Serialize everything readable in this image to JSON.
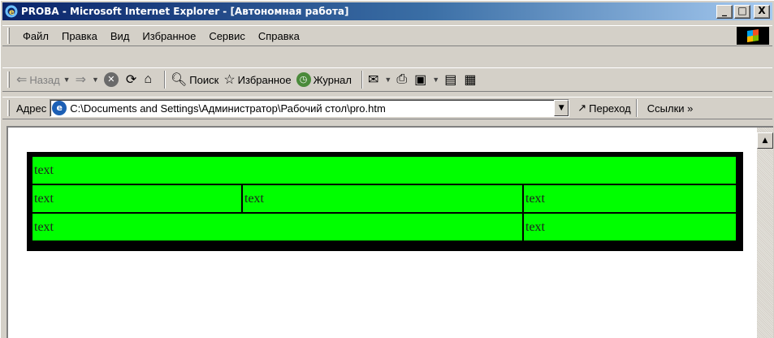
{
  "window": {
    "title": "PROBA - Microsoft Internet Explorer - [Автономная работа]",
    "buttons": {
      "minimize": "_",
      "maximize": "□",
      "close": "X"
    }
  },
  "menu": {
    "items": [
      "Файл",
      "Правка",
      "Вид",
      "Избранное",
      "Сервис",
      "Справка"
    ]
  },
  "toolbar": {
    "back_label": "Назад",
    "search_label": "Поиск",
    "favorites_label": "Избранное",
    "history_label": "Журнал"
  },
  "address": {
    "label": "Адрес",
    "value": "C:\\Documents and Settings\\Администратор\\Рабочий стол\\pro.htm",
    "go_label": "Переход",
    "links_label": "Ссылки »"
  },
  "page": {
    "rows": [
      [
        "text"
      ],
      [
        "text",
        "text",
        "text"
      ],
      [
        "text",
        "text"
      ]
    ]
  },
  "colors": {
    "table_bg": "#000000",
    "cell_bg": "#00ff00",
    "titlebar_start": "#0a246a"
  }
}
